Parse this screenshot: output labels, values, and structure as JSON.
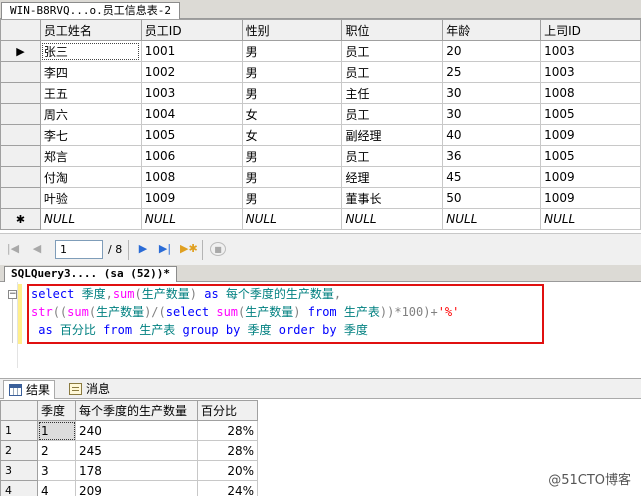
{
  "document_tab": {
    "title": "WIN-B8RVQ...o.员工信息表-2"
  },
  "grid": {
    "columns": [
      "员工姓名",
      "员工ID",
      "性别",
      "职位",
      "年龄",
      "上司ID"
    ],
    "rows": [
      [
        "张三",
        "1001",
        "男",
        "员工",
        "20",
        "1003"
      ],
      [
        "李四",
        "1002",
        "男",
        "员工",
        "25",
        "1003"
      ],
      [
        "王五",
        "1003",
        "男",
        "主任",
        "30",
        "1008"
      ],
      [
        "周六",
        "1004",
        "女",
        "员工",
        "30",
        "1005"
      ],
      [
        "李七",
        "1005",
        "女",
        "副经理",
        "40",
        "1009"
      ],
      [
        "郑言",
        "1006",
        "男",
        "员工",
        "36",
        "1005"
      ],
      [
        "付淘",
        "1008",
        "男",
        "经理",
        "45",
        "1009"
      ],
      [
        "叶验",
        "1009",
        "男",
        "董事长",
        "50",
        "1009"
      ],
      [
        "NULL",
        "NULL",
        "NULL",
        "NULL",
        "NULL",
        "NULL"
      ]
    ],
    "current_row_marker": "▶",
    "new_row_marker": "✱"
  },
  "navigator": {
    "page_value": "1",
    "page_total": "/ 8",
    "icons": [
      "first-record-icon",
      "previous-record-icon",
      "next-record-icon",
      "last-record-icon",
      "new-record-icon",
      "stop-icon"
    ]
  },
  "query_tab": {
    "title": "SQLQuery3.... (sa (52))*"
  },
  "editor": {
    "line1": [
      {
        "t": "select",
        "c": "kw"
      },
      {
        "t": " 季度",
        "c": "tx"
      },
      {
        "t": ",",
        "c": "op"
      },
      {
        "t": "sum",
        "c": "fn"
      },
      {
        "t": "(",
        "c": "op"
      },
      {
        "t": "生产数量",
        "c": "tx"
      },
      {
        "t": ")",
        "c": "op"
      },
      {
        "t": " as",
        "c": "kw"
      },
      {
        "t": " 每个季度的生产数量",
        "c": "tx"
      },
      {
        "t": ",",
        "c": "op"
      }
    ],
    "line2": [
      {
        "t": "str",
        "c": "fn"
      },
      {
        "t": "((",
        "c": "op"
      },
      {
        "t": "sum",
        "c": "fn"
      },
      {
        "t": "(",
        "c": "op"
      },
      {
        "t": "生产数量",
        "c": "tx"
      },
      {
        "t": ")/(",
        "c": "op"
      },
      {
        "t": "select",
        "c": "kw"
      },
      {
        "t": " ",
        "c": "tx"
      },
      {
        "t": "sum",
        "c": "fn"
      },
      {
        "t": "(",
        "c": "op"
      },
      {
        "t": "生产数量",
        "c": "tx"
      },
      {
        "t": ")",
        "c": "op"
      },
      {
        "t": " from",
        "c": "kw"
      },
      {
        "t": " 生产表",
        "c": "tx"
      },
      {
        "t": "))*100)+",
        "c": "op"
      },
      {
        "t": "'%'",
        "c": "str"
      }
    ],
    "line3": [
      {
        "t": " as",
        "c": "kw"
      },
      {
        "t": " 百分比",
        "c": "tx"
      },
      {
        "t": " from",
        "c": "kw"
      },
      {
        "t": " 生产表",
        "c": "tx"
      },
      {
        "t": " group",
        "c": "kw"
      },
      {
        "t": " by",
        "c": "kw"
      },
      {
        "t": " 季度",
        "c": "tx"
      },
      {
        "t": " order",
        "c": "kw"
      },
      {
        "t": " by",
        "c": "kw"
      },
      {
        "t": " 季度",
        "c": "tx"
      }
    ],
    "highlight_color": "#e01010"
  },
  "result_tabs": {
    "results": "结果",
    "messages": "消息"
  },
  "results": {
    "columns": [
      "季度",
      "每个季度的生产数量",
      "百分比"
    ],
    "rows": [
      [
        "1",
        "1",
        "240",
        "28%"
      ],
      [
        "2",
        "2",
        "245",
        "28%"
      ],
      [
        "3",
        "3",
        "178",
        "20%"
      ],
      [
        "4",
        "4",
        "209",
        "24%"
      ]
    ]
  },
  "watermark": "@51CTO博客"
}
